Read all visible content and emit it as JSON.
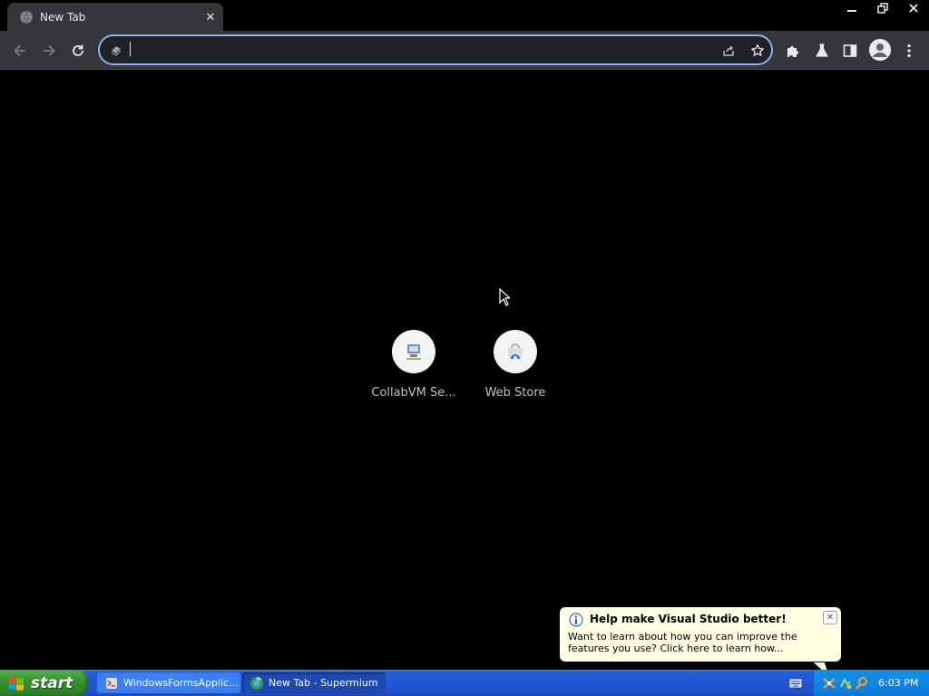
{
  "browser": {
    "tab": {
      "title": "New Tab",
      "close": "✕"
    },
    "window_controls": [
      "minimize",
      "restore",
      "close"
    ],
    "omnibox": {
      "value": "",
      "placeholder": ""
    }
  },
  "new_tab_page": {
    "shortcuts": [
      {
        "label": "CollabVM Se...",
        "icon": "collabvm-icon"
      },
      {
        "label": "Web Store",
        "icon": "web-store-icon"
      }
    ]
  },
  "balloon": {
    "title": "Help make Visual Studio better!",
    "text": "Want to learn about how you can improve the features you use? Click here to learn how...",
    "close": "✕"
  },
  "taskbar": {
    "start_label": "start",
    "items": [
      {
        "label": "WindowsFormsApplic...",
        "active": false
      },
      {
        "label": "New Tab - Supermium",
        "active": true
      }
    ],
    "clock": "6:03 PM"
  },
  "colors": {
    "focus_ring": "#8ab4f8",
    "toolbar_bg": "#35363a",
    "taskbar_blue": "#245edc",
    "start_green": "#3c9b34",
    "balloon_bg": "#ffffe1"
  }
}
